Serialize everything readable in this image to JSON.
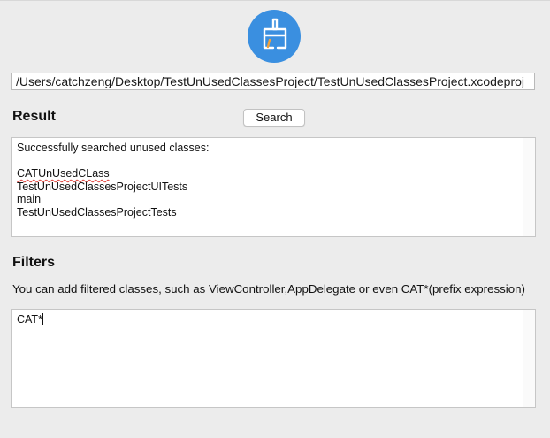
{
  "app": {
    "icon": "broom-icon",
    "accent_color": "#3a8fe0"
  },
  "project_path": "/Users/catchzeng/Desktop/TestUnUsedClassesProject/TestUnUsedClassesProject.xcodeproj",
  "result": {
    "title": "Result",
    "search_label": "Search",
    "lines": [
      "Successfully searched unused classes:",
      "",
      "CATUnUsedCLass",
      "TestUnUsedClassesProjectUITests",
      "main",
      "TestUnUsedClassesProjectTests"
    ]
  },
  "filters": {
    "title": "Filters",
    "hint": "You can add filtered classes, such as ViewController,AppDelegate or even CAT*(prefix expression)",
    "value": "CAT*"
  }
}
